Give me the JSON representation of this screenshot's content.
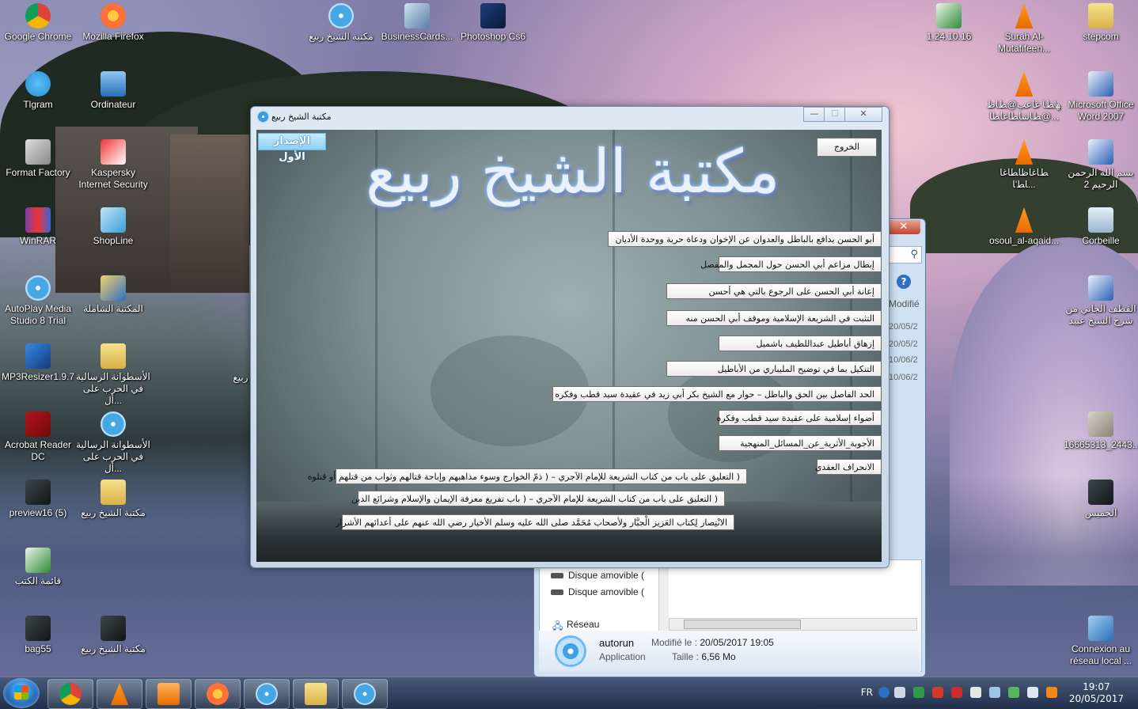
{
  "desktop": {
    "left_icons": [
      {
        "label": "Google Chrome",
        "icon": "chrome-icon"
      },
      {
        "label": "Mozilla Firefox",
        "icon": "firefox-icon"
      },
      {
        "label": "Tlgram",
        "icon": "telegram-icon"
      },
      {
        "label": "Ordinateur",
        "icon": "computer-icon"
      },
      {
        "label": "Format Factory",
        "icon": "format-factory-icon"
      },
      {
        "label": "Kaspersky Internet Security",
        "icon": "kaspersky-icon"
      },
      {
        "label": "WinRAR",
        "icon": "winrar-icon"
      },
      {
        "label": "ShopLine",
        "icon": "shopline-icon"
      },
      {
        "label": "AutoPlay Media Studio 8 Trial",
        "icon": "autoplay-icon"
      },
      {
        "label": "المكتبة الشاملة",
        "icon": "shamela-icon"
      },
      {
        "label": "MP3Resizer1.9.7",
        "icon": "music-note-icon"
      },
      {
        "label": "الأسطوانة الرسالية في الحرب على أل...",
        "icon": "folder-icon"
      },
      {
        "label": "Acrobat Reader DC",
        "icon": "acrobat-icon"
      },
      {
        "label": "الأسطوانة الرسالية في الحرب على أل...",
        "icon": "disc-icon"
      },
      {
        "label": "preview16 (5)",
        "icon": "image-icon"
      },
      {
        "label": "مكتبة الشيخ ربيع",
        "icon": "folder-icon"
      },
      {
        "label": "قائمة الكتب",
        "icon": "excel-icon"
      },
      {
        "label": "bag55",
        "icon": "image-icon"
      },
      {
        "label": "مكتبة الشيخ ربيع",
        "icon": "image-icon"
      }
    ],
    "partial_label": "ربيع",
    "top_icons": [
      {
        "label": "مكتبة الشيخ ربيع",
        "icon": "disc-icon"
      },
      {
        "label": "BusinessCards...",
        "icon": "businesscards-icon"
      },
      {
        "label": "Photoshop Cs6",
        "icon": "photoshop-icon"
      }
    ],
    "right_icons": [
      {
        "label": "1.24.10.16",
        "icon": "excel-icon"
      },
      {
        "label": "Surah Al-Mutafifeen...",
        "icon": "vlc-icon"
      },
      {
        "label": "stepcom",
        "icon": "folder-icon"
      },
      {
        "label": "ﻬ'ﻂﺎ ﻏﺎﻋﺐ@ﻂﺎﻇ ﻂﺎﺷﺎﻄﺎﻏﺎﻄﺎ@...",
        "icon": "vlc-icon"
      },
      {
        "label": "Microsoft Office Word 2007",
        "icon": "word-icon"
      },
      {
        "label": "ﻂﺎﻏﺎﻇﺎﻄﺎﻏﺎ ﺎﻄ'ﺎ...",
        "icon": "vlc-icon"
      },
      {
        "label": "بسم الله الرحمن الرحيم 2",
        "icon": "word-icon"
      },
      {
        "label": "osoul_al-aqaid...",
        "icon": "vlc-icon"
      },
      {
        "label": "Corbeille",
        "icon": "recycle-bin-icon"
      },
      {
        "label": "القطف الجاني من شرح الشيخ عبيد",
        "icon": "word-icon"
      },
      {
        "label": "16665313_2443...",
        "icon": "book-icon"
      },
      {
        "label": "الخميس",
        "icon": "image-icon"
      },
      {
        "label": "Connexion au réseau local ...",
        "icon": "network-icon"
      }
    ]
  },
  "app_window": {
    "title": "مكتبة الشيخ ربيع",
    "logo_text": "مكتبة الشيخ ربيع",
    "version_button": "الإصدار الأول",
    "exit_button": "الخروج",
    "controls": {
      "minimize": "—",
      "maximize": "☐",
      "close": "✕"
    },
    "books": [
      "أبو الحسن يدافع بالباطل والعدوان عن الإخوان ودعاة حرية ووحدة الأديان",
      "إبطال مزاعم أبي الحسن حول المجمل والمفصل",
      "إعانة أبي الحسن على الرجوع بالتي هي أحسن",
      "التثبت في الشريعة الإسلامية وموقف أبي الحسن منه",
      "إزهاق أباطيل عبداللطيف باشميل",
      "التنكيل بما في توضيح المليباري من الأباطيل",
      "الحد الفاصل بين الحق والباطل – حوار مع الشيخ بكر أبي زيد في عقيدة سيد قطب وفكره",
      "أضواء إسلامية على عقيدة سيد قطب وفكره",
      "الأجوبة_الأثرية_عن_المسائل_المنهجية",
      "الانحراف العقدي",
      "( التعليق على باب من كتاب الشريعة للإمام الآجري – ( ذمّ الخوارج وسوء مذاهبهم وإباحة قتالهم وثواب من قتلهم أو قتلوه",
      "( التعليق على باب من كتاب الشريعة للإمام الآجري – ( باب تفريغ معرفة الإيمان والإسلام وشرائع الدين",
      "الانْتِصار لِكتاب العَزيز الْجبَّار ولأصحاب مُحَمَّد صلى الله عليه وسلم الأخيار رضي الله عنهم على أعدائهم الأشرار"
    ]
  },
  "explorer": {
    "close": "✕",
    "column_header": "Modifié",
    "dates": [
      "20/05/2",
      "20/05/2",
      "10/06/2",
      "10/06/2"
    ],
    "drives": [
      "Disque amovible (",
      "Disque amovible ("
    ],
    "network": "Réseau",
    "file": {
      "name": "autorun",
      "type": "Application",
      "modified_label": "Modifié le :",
      "modified_value": "20/05/2017 19:05",
      "size_label": "Taille :",
      "size_value": "6,56 Mo"
    }
  },
  "taskbar": {
    "language": "FR",
    "time": "19:07",
    "date": "20/05/2017",
    "pinned": [
      "chrome-icon",
      "vlc-icon",
      "media-player-icon",
      "firefox-icon",
      "disc-icon",
      "explorer-icon",
      "disc-icon"
    ]
  },
  "colors": {
    "version_button": "#8fd0f5",
    "taskbar": "#2a3c5a",
    "explorer_close": "#c5432f"
  }
}
